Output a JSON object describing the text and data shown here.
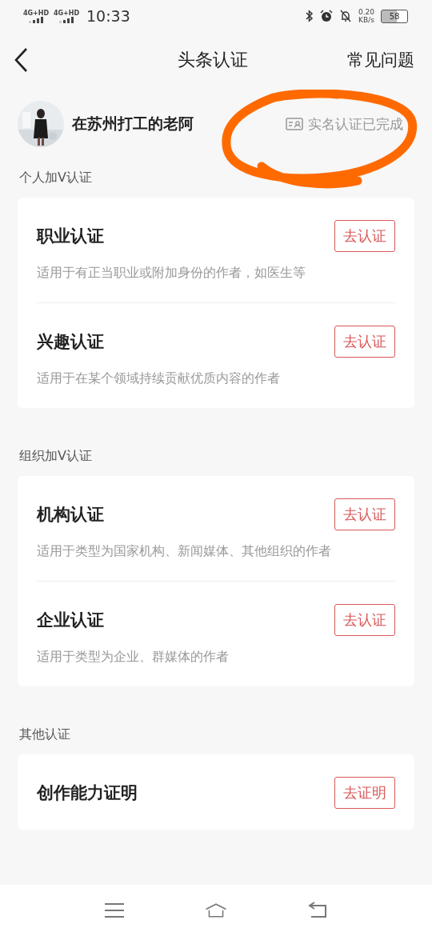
{
  "status_bar": {
    "network_labels": [
      "4G+HD",
      "4G+HD"
    ],
    "time": "10:33",
    "speed": "0.20",
    "speed_unit": "KB/s",
    "battery": "58"
  },
  "header": {
    "title": "头条认证",
    "help": "常见问题"
  },
  "profile": {
    "name": "在苏州打工的老阿",
    "verification": "实名认证已完成"
  },
  "sections": [
    {
      "label": "个人加V认证",
      "items": [
        {
          "title": "职业认证",
          "description": "适用于有正当职业或附加身份的作者，如医生等",
          "action": "去认证"
        },
        {
          "title": "兴趣认证",
          "description": "适用于在某个领域持续贡献优质内容的作者",
          "action": "去认证"
        }
      ]
    },
    {
      "label": "组织加V认证",
      "items": [
        {
          "title": "机构认证",
          "description": "适用于类型为国家机构、新闻媒体、其他组织的作者",
          "action": "去认证"
        },
        {
          "title": "企业认证",
          "description": "适用于类型为企业、群媒体的作者",
          "action": "去认证"
        }
      ]
    },
    {
      "label": "其他认证",
      "items": [
        {
          "title": "创作能力证明",
          "action": "去证明"
        }
      ]
    }
  ]
}
